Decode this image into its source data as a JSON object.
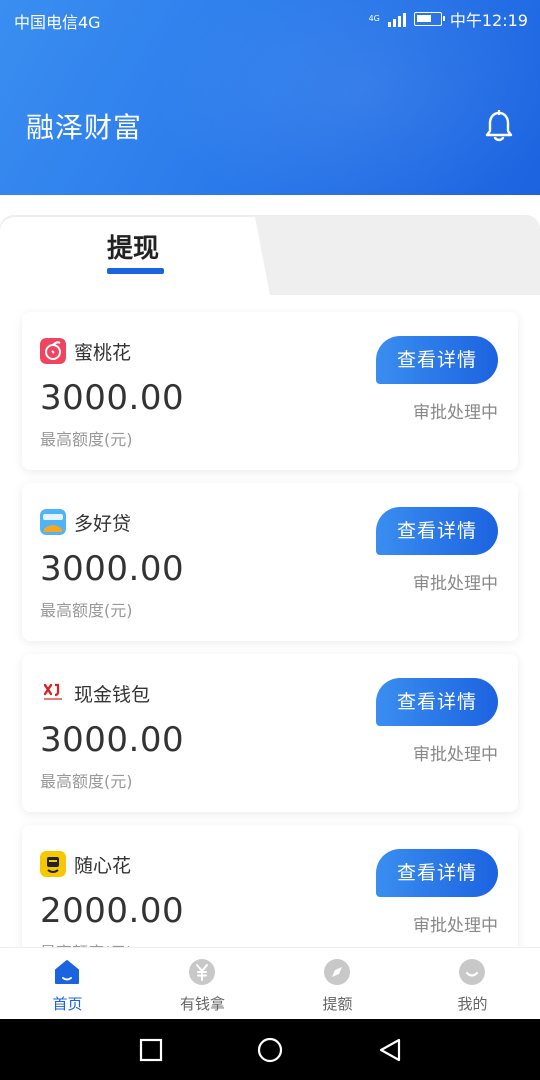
{
  "status_bar": {
    "carrier": "中国电信4G",
    "net_small": "4G",
    "time": "中午12:19"
  },
  "header": {
    "title": "融泽财富",
    "notification_icon": "bell-icon"
  },
  "tabs": [
    {
      "label": "提现",
      "active": true
    }
  ],
  "loans": [
    {
      "name": "蜜桃花",
      "logo": "peach-logo",
      "amount": "3000.00",
      "amount_label": "最高额度(元)",
      "button": "查看详情",
      "status": "审批处理中"
    },
    {
      "name": "多好贷",
      "logo": "duohaodai-logo",
      "amount": "3000.00",
      "amount_label": "最高额度(元)",
      "button": "查看详情",
      "status": "审批处理中"
    },
    {
      "name": "现金钱包",
      "logo": "cash-wallet-logo",
      "amount": "3000.00",
      "amount_label": "最高额度(元)",
      "button": "查看详情",
      "status": "审批处理中"
    },
    {
      "name": "随心花",
      "logo": "suixinhua-logo",
      "amount": "2000.00",
      "amount_label": "最高额度(元)",
      "button": "查看详情",
      "status": "审批处理中"
    }
  ],
  "bottom_nav": [
    {
      "label": "首页",
      "icon": "home-icon",
      "active": true
    },
    {
      "label": "有钱拿",
      "icon": "yen-coin-icon",
      "active": false
    },
    {
      "label": "提额",
      "icon": "compass-icon",
      "active": false
    },
    {
      "label": "我的",
      "icon": "smile-icon",
      "active": false
    }
  ],
  "colors": {
    "primary": "#1c63e0",
    "header_start": "#3a8ef0",
    "text_primary": "#333333",
    "text_secondary": "#999999"
  }
}
